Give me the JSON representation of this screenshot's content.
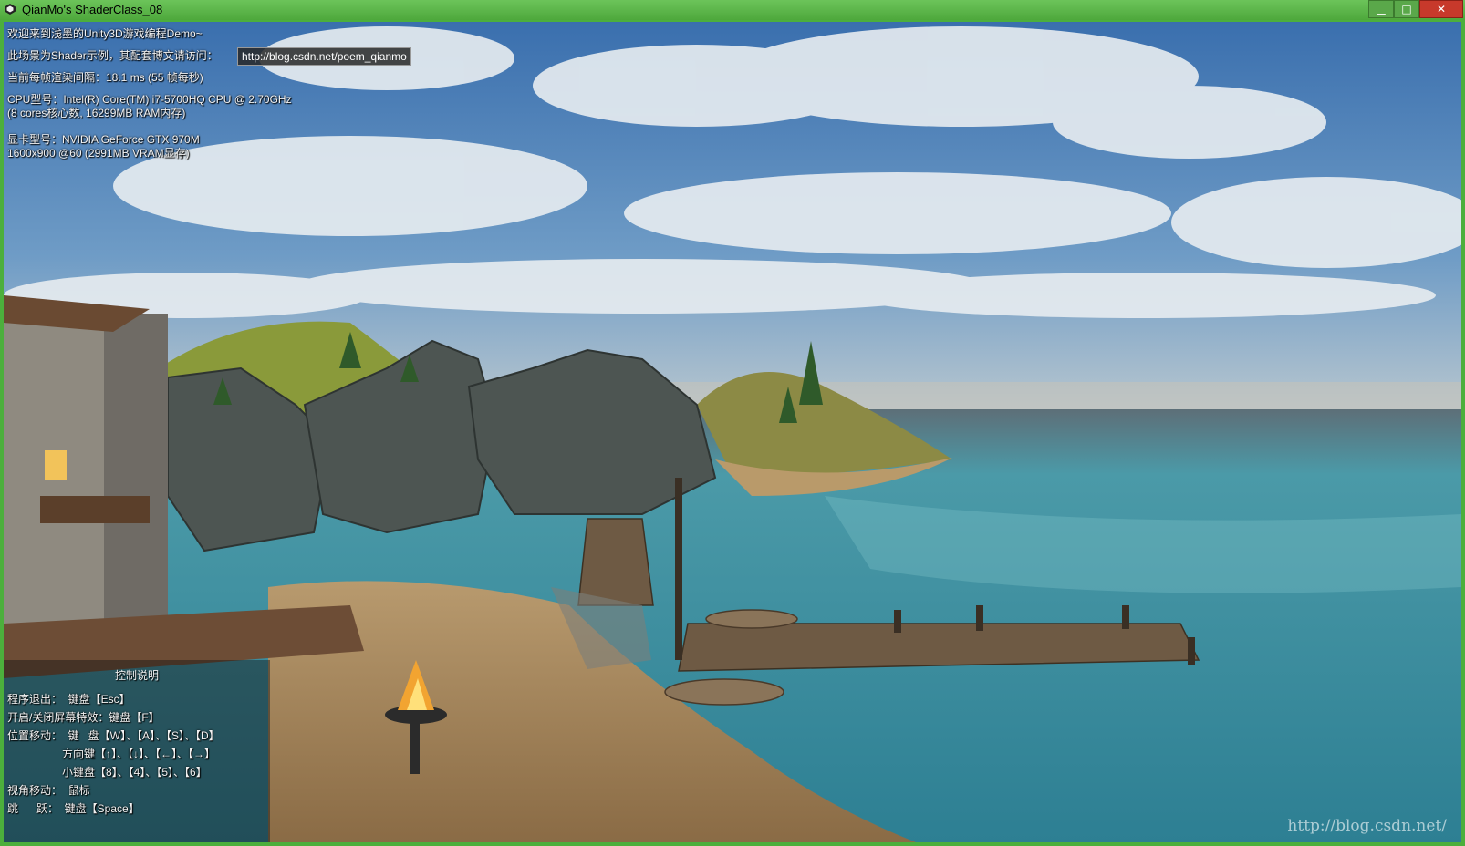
{
  "window": {
    "title": "QianMo's ShaderClass_08",
    "minimize_glyph": "▁",
    "maximize_glyph": "□",
    "close_glyph": "✕"
  },
  "hud": {
    "welcome": "欢迎来到浅墨的Unity3D游戏编程Demo~",
    "scene_note": "此场景为Shader示例，其配套博文请访问：",
    "url": "http://blog.csdn.net/poem_qianmo",
    "frame_interval": "当前每帧渲染间隔：18.1 ms (55 帧每秒)",
    "cpu_line1": "CPU型号：Intel(R) Core(TM) i7-5700HQ CPU @ 2.70GHz",
    "cpu_line2": "(8 cores核心数, 16299MB RAM内存)",
    "gpu_line1": "显卡型号：NVIDIA GeForce GTX 970M",
    "gpu_line2": "1600x900 @60 (2991MB VRAM显存)"
  },
  "controls": {
    "title": "控制说明",
    "lines": [
      "程序退出：  键盘【Esc】",
      "开启/关闭屏幕特效：键盘【F】",
      "位置移动：  键   盘【W】、【A】、【S】、【D】",
      "                  方向键【↑】、【↓】、【←】、【→】",
      "                  小键盘【8】、【4】、【5】、【6】",
      "视角移动：  鼠标",
      "跳      跃：  键盘【Space】"
    ]
  },
  "watermark": "http://blog.csdn.net/",
  "colors": {
    "titlebar": "#5cb84a",
    "sky": "#3b6fa6",
    "sea": "#3f8fa0"
  }
}
